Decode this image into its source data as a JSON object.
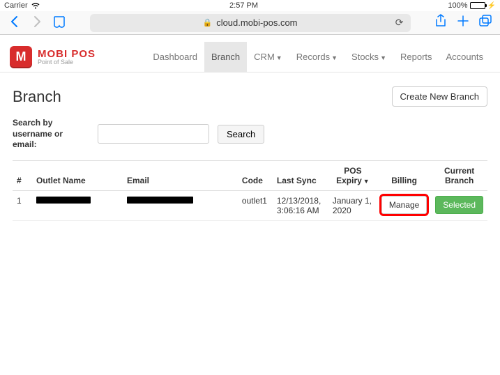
{
  "status": {
    "carrier": "Carrier",
    "time": "2:57 PM",
    "battery_pct": "100%"
  },
  "browser": {
    "url": "cloud.mobi-pos.com"
  },
  "brand": {
    "logo_letter": "M",
    "name": "MOBI POS",
    "subtitle": "Point of Sale"
  },
  "nav": {
    "dashboard": "Dashboard",
    "branch": "Branch",
    "crm": "CRM",
    "records": "Records",
    "stocks": "Stocks",
    "reports": "Reports",
    "accounts": "Accounts"
  },
  "page_title": "Branch",
  "create_btn": "Create New Branch",
  "search_label": "Search by username or email:",
  "search_btn": "Search",
  "columns": {
    "index": "#",
    "outlet": "Outlet Name",
    "email": "Email",
    "code": "Code",
    "last_sync": "Last Sync",
    "pos_expiry": "POS Expiry",
    "billing": "Billing",
    "current_branch": "Current Branch"
  },
  "row": {
    "index": "1",
    "code": "outlet1",
    "last_sync": "12/13/2018, 3:06:16 AM",
    "pos_expiry": "January 1, 2020",
    "billing_btn": "Manage",
    "current_btn": "Selected"
  }
}
